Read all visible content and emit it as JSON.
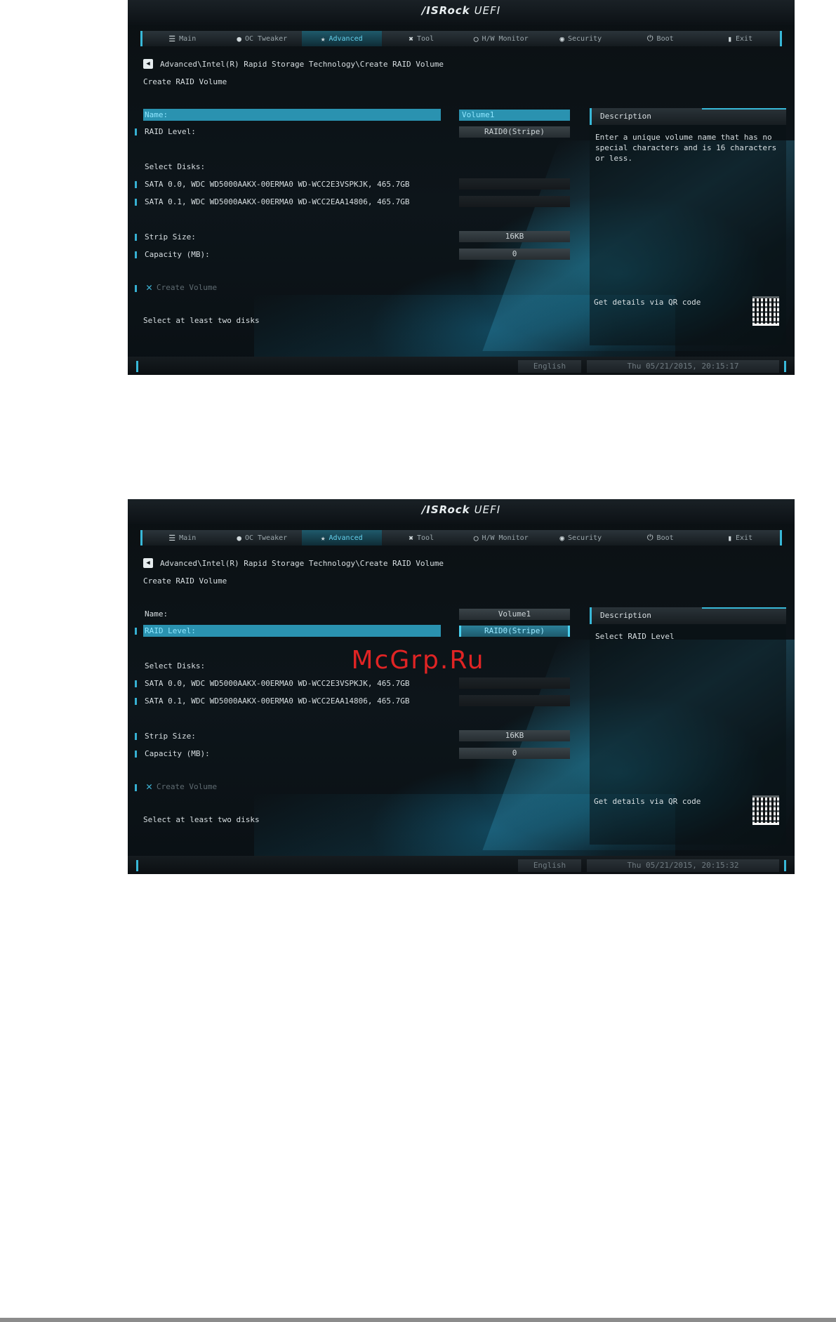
{
  "header": {
    "logo_brand": "/ISRock",
    "logo_product": "UEFI"
  },
  "tabs": [
    {
      "label": "Main",
      "icon": "☰"
    },
    {
      "label": "OC Tweaker",
      "icon": "●"
    },
    {
      "label": "Advanced",
      "icon": "★"
    },
    {
      "label": "Tool",
      "icon": "✖"
    },
    {
      "label": "H/W Monitor",
      "icon": "◯"
    },
    {
      "label": "Security",
      "icon": "◉"
    },
    {
      "label": "Boot",
      "icon": "⏻"
    },
    {
      "label": "Exit",
      "icon": "▮"
    }
  ],
  "screen1": {
    "breadcrumb": "Advanced\\Intel(R) Rapid Storage Technology\\Create RAID Volume",
    "subtitle": "Create RAID Volume",
    "name_label": "Name:",
    "name_value": "Volume1",
    "raid_label": "RAID Level:",
    "raid_value": "RAID0(Stripe)",
    "select_disks_label": "Select Disks:",
    "disk1": "SATA 0.0, WDC WD5000AAKX-00ERMA0 WD-WCC2E3VSPKJK, 465.7GB",
    "disk2": "SATA 0.1, WDC WD5000AAKX-00ERMA0 WD-WCC2EAA14806, 465.7GB",
    "strip_label": "Strip Size:",
    "strip_value": "16KB",
    "capacity_label": "Capacity (MB):",
    "capacity_value": "0",
    "create_label": "Create Volume",
    "note": "Select at least two disks",
    "desc_title": "Description",
    "desc_text": "Enter a unique volume name that has no special characters and is 16 characters or less.",
    "qr_label": "Get details via QR code",
    "language": "English",
    "datetime": "Thu 05/21/2015, 20:15:17"
  },
  "screen2": {
    "breadcrumb": "Advanced\\Intel(R) Rapid Storage Technology\\Create RAID Volume",
    "subtitle": "Create RAID Volume",
    "name_label": "Name:",
    "name_value": "Volume1",
    "raid_label": "RAID Level:",
    "raid_value": "RAID0(Stripe)",
    "select_disks_label": "Select Disks:",
    "disk1": "SATA 0.0, WDC WD5000AAKX-00ERMA0 WD-WCC2E3VSPKJK, 465.7GB",
    "disk2": "SATA 0.1, WDC WD5000AAKX-00ERMA0 WD-WCC2EAA14806, 465.7GB",
    "strip_label": "Strip Size:",
    "strip_value": "16KB",
    "capacity_label": "Capacity (MB):",
    "capacity_value": "0",
    "create_label": "Create Volume",
    "note": "Select at least two disks",
    "desc_title": "Description",
    "desc_text": "Select RAID Level",
    "qr_label": "Get details via QR code",
    "language": "English",
    "datetime": "Thu 05/21/2015, 20:15:32"
  },
  "watermark": "McGrp.Ru",
  "colors": {
    "accent": "#38b8d8",
    "selection": "#2a92b0",
    "background": "#0b1013",
    "watermark": "#e02424"
  }
}
